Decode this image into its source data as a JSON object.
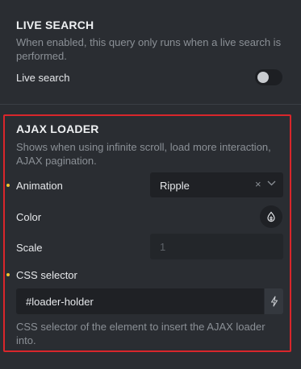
{
  "live_search": {
    "title": "LIVE SEARCH",
    "description": "When enabled, this query only runs when a live search is performed.",
    "toggle_label": "Live search",
    "toggle_on": false
  },
  "ajax_loader": {
    "title": "AJAX LOADER",
    "description": "Shows when using infinite scroll, load more interaction, AJAX pagination.",
    "animation": {
      "label": "Animation",
      "value": "Ripple",
      "clear_symbol": "×"
    },
    "color": {
      "label": "Color",
      "icon": "color-picker-icon"
    },
    "scale": {
      "label": "Scale",
      "placeholder": "1"
    },
    "css_selector": {
      "label": "CSS selector",
      "value": "#loader-holder",
      "help": "CSS selector of the element to insert the AJAX loader into."
    }
  },
  "colors": {
    "background": "#2a2d32",
    "highlight": "#d9262b",
    "modified_dot": "#f1c232"
  }
}
